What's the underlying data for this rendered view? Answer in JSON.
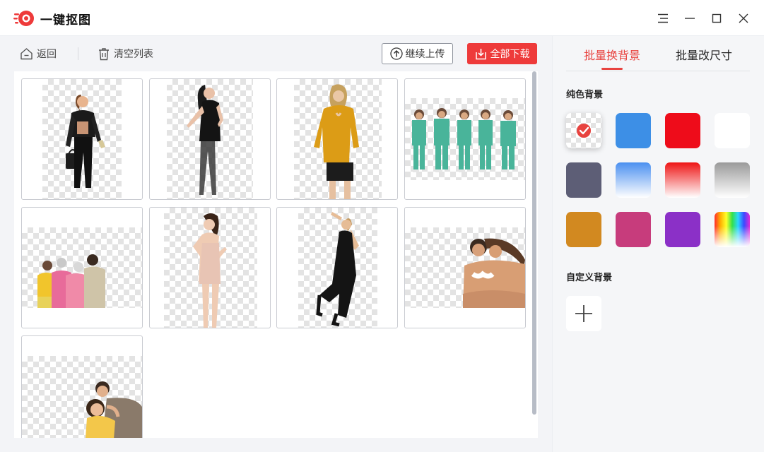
{
  "app": {
    "title": "一键抠图"
  },
  "toolbar": {
    "back_label": "返回",
    "clear_label": "清空列表",
    "upload_label": "继续上传",
    "download_label": "全部下载"
  },
  "right_panel": {
    "tabs": [
      {
        "label": "批量换背景",
        "active": true
      },
      {
        "label": "批量改尺寸",
        "active": false
      }
    ],
    "solid_bg_title": "纯色背景",
    "custom_bg_title": "自定义背景",
    "swatches": [
      {
        "name": "transparent",
        "selected": true
      },
      {
        "name": "blue",
        "color": "#3d8fe6"
      },
      {
        "name": "red",
        "color": "#ee0c1a"
      },
      {
        "name": "white",
        "color": "#ffffff"
      },
      {
        "name": "slate",
        "color": "#5d5e76"
      },
      {
        "name": "blue-gradient",
        "color": "#4b90f0"
      },
      {
        "name": "red-gradient",
        "color": "#ee1515"
      },
      {
        "name": "gray-gradient",
        "color": "#9a9a9a"
      },
      {
        "name": "amber",
        "color": "#d28920"
      },
      {
        "name": "magenta",
        "color": "#c73c7c"
      },
      {
        "name": "purple",
        "color": "#8b30c7"
      },
      {
        "name": "rainbow",
        "color": "multi"
      }
    ]
  },
  "images": [
    {
      "id": 1,
      "subject": "woman-black-jacket"
    },
    {
      "id": 2,
      "subject": "woman-black-dress"
    },
    {
      "id": 3,
      "subject": "woman-yellow-sweater"
    },
    {
      "id": 4,
      "subject": "medical-team"
    },
    {
      "id": 5,
      "subject": "family-group"
    },
    {
      "id": 6,
      "subject": "woman-beige-dress"
    },
    {
      "id": 7,
      "subject": "woman-black-gown"
    },
    {
      "id": 8,
      "subject": "beach-couple"
    },
    {
      "id": 9,
      "subject": "hugging-pair"
    }
  ],
  "colors": {
    "accent": "#ee3a3a",
    "panel_bg": "#f5f6f8",
    "app_bg": "#f3f4f7"
  }
}
